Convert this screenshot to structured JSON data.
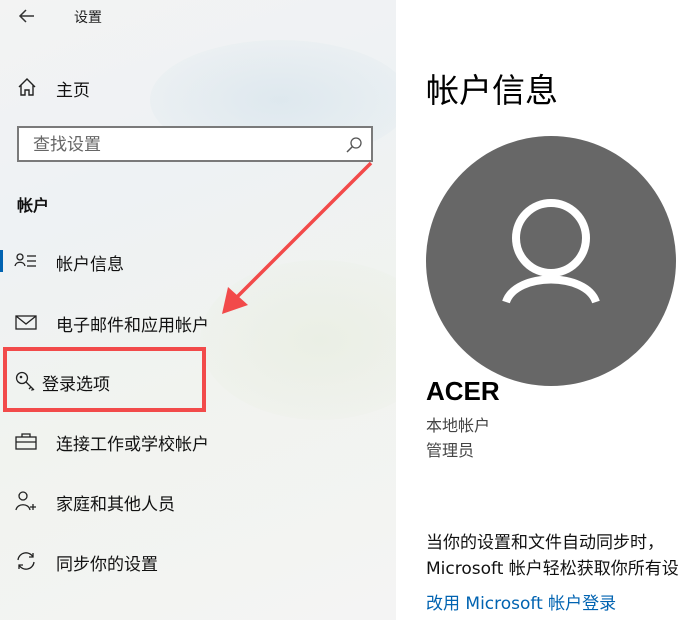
{
  "window": {
    "title": "设置"
  },
  "sidebar": {
    "home_label": "主页",
    "search": {
      "placeholder": "查找设置"
    },
    "section_header": "帐户",
    "items": [
      {
        "label": "帐户信息",
        "icon": "account-info-icon",
        "selected": true
      },
      {
        "label": "电子邮件和应用帐户",
        "icon": "mail-icon"
      },
      {
        "label": "登录选项",
        "icon": "key-icon"
      },
      {
        "label": "连接工作或学校帐户",
        "icon": "briefcase-icon"
      },
      {
        "label": "家庭和其他人员",
        "icon": "person-add-icon"
      },
      {
        "label": "同步你的设置",
        "icon": "sync-icon"
      }
    ]
  },
  "main": {
    "title": "帐户信息",
    "user": {
      "name": "ACER",
      "type": "本地帐户",
      "role": "管理员"
    },
    "sync_text_line1": "当你的设置和文件自动同步时，",
    "sync_text_line2": "Microsoft 帐户轻松获取你所有设",
    "sync_link": "改用 Microsoft 帐户登录"
  },
  "colors": {
    "accent": "#0063b1",
    "annotation_red": "#f24a4a",
    "avatar_bg": "#676767"
  }
}
